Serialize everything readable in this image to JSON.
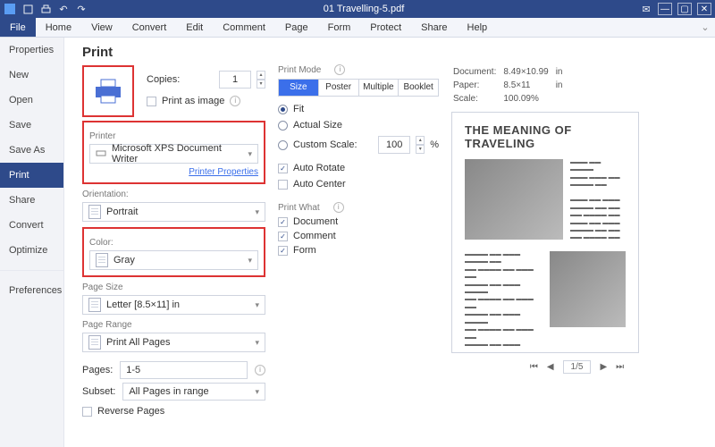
{
  "window": {
    "title": "01 Travelling-5.pdf"
  },
  "ribbon": {
    "tabs": [
      "File",
      "Home",
      "View",
      "Convert",
      "Edit",
      "Comment",
      "Page",
      "Form",
      "Protect",
      "Share",
      "Help"
    ],
    "active_index": 0
  },
  "sidebar": {
    "items": [
      "Properties",
      "New",
      "Open",
      "Save",
      "Save As",
      "Print",
      "Share",
      "Convert",
      "Optimize",
      "Preferences"
    ],
    "active_index": 5
  },
  "print": {
    "title": "Print",
    "copies_label": "Copies:",
    "copies_value": "1",
    "print_as_image": {
      "checked": false,
      "label": "Print as image"
    },
    "printer_section": "Printer",
    "printer_value": "Microsoft XPS Document Writer",
    "printer_props_link": "Printer Properties",
    "orientation_section": "Orientation:",
    "orientation_value": "Portrait",
    "color_section": "Color:",
    "color_value": "Gray",
    "page_size_section": "Page Size",
    "page_size_value": "Letter [8.5×11] in",
    "page_range_section": "Page Range",
    "page_range_value": "Print All Pages",
    "pages_label": "Pages:",
    "pages_value": "1-5",
    "subset_label": "Subset:",
    "subset_value": "All Pages in range",
    "reverse_label": "Reverse Pages"
  },
  "mode": {
    "section": "Print Mode",
    "tabs": [
      "Size",
      "Poster",
      "Multiple",
      "Booklet"
    ],
    "active_index": 0,
    "fit": "Fit",
    "actual": "Actual Size",
    "custom": "Custom Scale:",
    "custom_value": "100",
    "custom_unit": "%",
    "auto_rotate": {
      "checked": true,
      "label": "Auto Rotate"
    },
    "auto_center": {
      "checked": false,
      "label": "Auto Center"
    },
    "print_what_section": "Print What",
    "pw_document": {
      "checked": true,
      "label": "Document"
    },
    "pw_comment": {
      "checked": true,
      "label": "Comment"
    },
    "pw_form": {
      "checked": true,
      "label": "Form"
    }
  },
  "preview_meta": {
    "doc_label": "Document:",
    "doc_value": "8.49×10.99",
    "doc_unit": "in",
    "paper_label": "Paper:",
    "paper_value": "8.5×11",
    "paper_unit": "in",
    "scale_label": "Scale:",
    "scale_value": "100.09%"
  },
  "preview_doc": {
    "heading": "THE MEANING OF TRAVELING"
  },
  "pager": {
    "page": "1",
    "sep": "/",
    "total": "5"
  }
}
